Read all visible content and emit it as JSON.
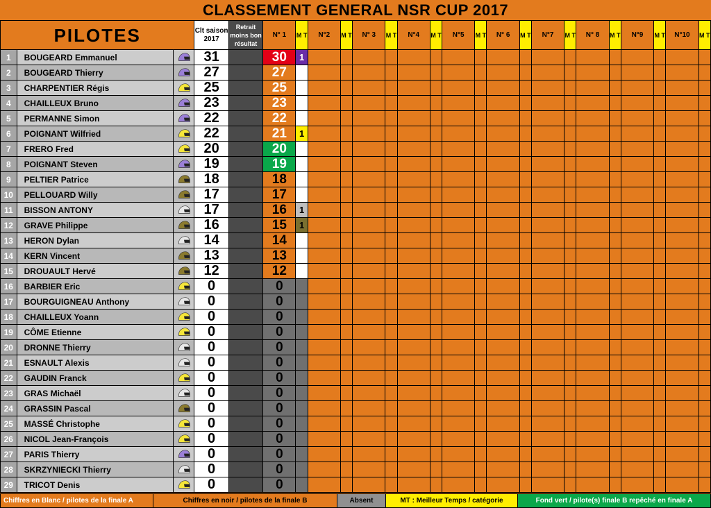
{
  "title": "CLASSEMENT GENERAL NSR CUP 2017",
  "headers": {
    "pilotes": "PILOTES",
    "clt": "Clt saison 2017",
    "retrait": "Retrait moins bon résultat",
    "mt": "M T",
    "races": [
      "N° 1",
      "N°2",
      "N° 3",
      "N°4",
      "N°5",
      "N° 6",
      "N°7",
      "N° 8",
      "N°9",
      "N°10"
    ]
  },
  "rows": [
    {
      "rank": 1,
      "name": "BOUGEARD Emmanuel",
      "helmet": "purple",
      "clt": "31",
      "n1": {
        "v": "30",
        "bg": "#e30016",
        "fg": "#fff"
      },
      "mt": {
        "v": "1",
        "bg": "#6a2da8",
        "fg": "#fff"
      }
    },
    {
      "rank": 2,
      "name": "BOUGEARD Thierry",
      "helmet": "purple",
      "clt": "27",
      "n1": {
        "v": "27",
        "bg": "#e37b1e",
        "fg": "#fff"
      },
      "mt": null
    },
    {
      "rank": 3,
      "name": "CHARPENTIER Régis",
      "helmet": "yellow",
      "clt": "25",
      "n1": {
        "v": "25",
        "bg": "#e37b1e",
        "fg": "#fff"
      },
      "mt": null
    },
    {
      "rank": 4,
      "name": "CHAILLEUX   Bruno",
      "helmet": "purple",
      "clt": "23",
      "n1": {
        "v": "23",
        "bg": "#e37b1e",
        "fg": "#fff"
      },
      "mt": null
    },
    {
      "rank": 5,
      "name": "PERMANNE Simon",
      "helmet": "purple",
      "clt": "22",
      "n1": {
        "v": "22",
        "bg": "#e37b1e",
        "fg": "#fff"
      },
      "mt": null
    },
    {
      "rank": 6,
      "name": "POIGNANT  Wilfried",
      "helmet": "yellow",
      "clt": "22",
      "n1": {
        "v": "21",
        "bg": "#e37b1e",
        "fg": "#fff"
      },
      "mt": {
        "v": "1",
        "bg": "#ffee00",
        "fg": "#000"
      }
    },
    {
      "rank": 7,
      "name": "FRERO  Fred",
      "helmet": "yellow",
      "clt": "20",
      "n1": {
        "v": "20",
        "bg": "#0aa84a",
        "fg": "#fff"
      },
      "mt": null
    },
    {
      "rank": 8,
      "name": "POIGNANT Steven",
      "helmet": "purple",
      "clt": "19",
      "n1": {
        "v": "19",
        "bg": "#0aa84a",
        "fg": "#fff"
      },
      "mt": null
    },
    {
      "rank": 9,
      "name": "PELTIER  Patrice",
      "helmet": "olive",
      "clt": "18",
      "n1": {
        "v": "18",
        "bg": "#e37b1e",
        "fg": "#000"
      },
      "mt": null
    },
    {
      "rank": 10,
      "name": "PELLOUARD  Willy",
      "helmet": "olive",
      "clt": "17",
      "n1": {
        "v": "17",
        "bg": "#e37b1e",
        "fg": "#000"
      },
      "mt": null
    },
    {
      "rank": 11,
      "name": "BISSON ANTONY",
      "helmet": "white",
      "clt": "17",
      "n1": {
        "v": "16",
        "bg": "#e37b1e",
        "fg": "#000"
      },
      "mt": {
        "v": "1",
        "bg": "#bfbfbf",
        "fg": "#000"
      }
    },
    {
      "rank": 12,
      "name": "GRAVE  Philippe",
      "helmet": "olive",
      "clt": "16",
      "n1": {
        "v": "15",
        "bg": "#e37b1e",
        "fg": "#000"
      },
      "mt": {
        "v": "1",
        "bg": "#7a7030",
        "fg": "#000"
      }
    },
    {
      "rank": 13,
      "name": "HERON Dylan",
      "helmet": "white",
      "clt": "14",
      "n1": {
        "v": "14",
        "bg": "#e37b1e",
        "fg": "#000"
      },
      "mt": null
    },
    {
      "rank": 14,
      "name": "KERN Vincent",
      "helmet": "olive",
      "clt": "13",
      "n1": {
        "v": "13",
        "bg": "#e37b1e",
        "fg": "#000"
      },
      "mt": null
    },
    {
      "rank": 15,
      "name": "DROUAULT Hervé",
      "helmet": "olive",
      "clt": "12",
      "n1": {
        "v": "12",
        "bg": "#e37b1e",
        "fg": "#000"
      },
      "mt": null
    },
    {
      "rank": 16,
      "name": "BARBIER Eric",
      "helmet": "yellow",
      "clt": "0",
      "n1": {
        "v": "0",
        "bg": "#707070",
        "fg": "#000"
      },
      "mt": {
        "v": "",
        "bg": "#707070",
        "fg": "#000"
      }
    },
    {
      "rank": 17,
      "name": "BOURGUIGNEAU Anthony",
      "helmet": "white",
      "clt": "0",
      "n1": {
        "v": "0",
        "bg": "#707070",
        "fg": "#000"
      },
      "mt": {
        "v": "",
        "bg": "#707070",
        "fg": "#000"
      }
    },
    {
      "rank": 18,
      "name": "CHAILLEUX Yoann",
      "helmet": "yellow",
      "clt": "0",
      "n1": {
        "v": "0",
        "bg": "#707070",
        "fg": "#000"
      },
      "mt": {
        "v": "",
        "bg": "#707070",
        "fg": "#000"
      }
    },
    {
      "rank": 19,
      "name": "CÔME Etienne",
      "helmet": "yellow",
      "clt": "0",
      "n1": {
        "v": "0",
        "bg": "#707070",
        "fg": "#000"
      },
      "mt": {
        "v": "",
        "bg": "#707070",
        "fg": "#000"
      }
    },
    {
      "rank": 20,
      "name": "DRONNE Thierry",
      "helmet": "white",
      "clt": "0",
      "n1": {
        "v": "0",
        "bg": "#707070",
        "fg": "#000"
      },
      "mt": {
        "v": "",
        "bg": "#707070",
        "fg": "#000"
      }
    },
    {
      "rank": 21,
      "name": "ESNAULT  Alexis",
      "helmet": "white",
      "clt": "0",
      "n1": {
        "v": "0",
        "bg": "#707070",
        "fg": "#000"
      },
      "mt": {
        "v": "",
        "bg": "#707070",
        "fg": "#000"
      }
    },
    {
      "rank": 22,
      "name": "GAUDIN Franck",
      "helmet": "yellow",
      "clt": "0",
      "n1": {
        "v": "0",
        "bg": "#707070",
        "fg": "#000"
      },
      "mt": {
        "v": "",
        "bg": "#707070",
        "fg": "#000"
      }
    },
    {
      "rank": 23,
      "name": "GRAS Michaël",
      "helmet": "white",
      "clt": "0",
      "n1": {
        "v": "0",
        "bg": "#707070",
        "fg": "#000"
      },
      "mt": {
        "v": "",
        "bg": "#707070",
        "fg": "#000"
      }
    },
    {
      "rank": 24,
      "name": "GRASSIN Pascal",
      "helmet": "olive",
      "clt": "0",
      "n1": {
        "v": "0",
        "bg": "#707070",
        "fg": "#000"
      },
      "mt": {
        "v": "",
        "bg": "#707070",
        "fg": "#000"
      }
    },
    {
      "rank": 25,
      "name": "MASSÉ Christophe",
      "helmet": "yellow",
      "clt": "0",
      "n1": {
        "v": "0",
        "bg": "#707070",
        "fg": "#000"
      },
      "mt": {
        "v": "",
        "bg": "#707070",
        "fg": "#000"
      }
    },
    {
      "rank": 26,
      "name": "NICOL Jean-François",
      "helmet": "yellow",
      "clt": "0",
      "n1": {
        "v": "0",
        "bg": "#707070",
        "fg": "#000"
      },
      "mt": {
        "v": "",
        "bg": "#707070",
        "fg": "#000"
      }
    },
    {
      "rank": 27,
      "name": "PARIS  Thierry",
      "helmet": "purple",
      "clt": "0",
      "n1": {
        "v": "0",
        "bg": "#707070",
        "fg": "#000"
      },
      "mt": {
        "v": "",
        "bg": "#707070",
        "fg": "#000"
      }
    },
    {
      "rank": 28,
      "name": "SKRZYNIECKI Thierry",
      "helmet": "white",
      "clt": "0",
      "n1": {
        "v": "0",
        "bg": "#707070",
        "fg": "#000"
      },
      "mt": {
        "v": "",
        "bg": "#707070",
        "fg": "#000"
      }
    },
    {
      "rank": 29,
      "name": "TRICOT Denis",
      "helmet": "yellow",
      "clt": "0",
      "n1": {
        "v": "0",
        "bg": "#707070",
        "fg": "#000"
      },
      "mt": {
        "v": "",
        "bg": "#707070",
        "fg": "#000"
      }
    }
  ],
  "legend": {
    "white": "Chiffres en Blanc  /  pilotes de la  finale A",
    "black": "Chiffres en noir  /  pilotes de la finale B",
    "absent": "Absent",
    "mt": "MT : Meilleur Temps / catégorie",
    "green": "Fond vert  /  pilote(s)  finale B repêché en finale  A"
  },
  "helmet_colors": {
    "purple": "#9a7fd6",
    "yellow": "#f5e63a",
    "olive": "#8a7a2e",
    "white": "#e8e8e8"
  }
}
